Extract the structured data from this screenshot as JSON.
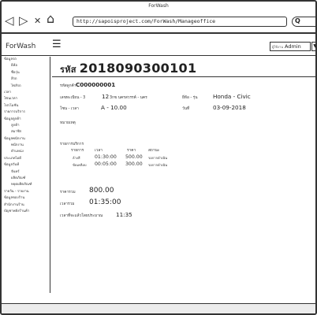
{
  "window": {
    "title": "ForWash"
  },
  "browser": {
    "back_icon": "◁",
    "forward_icon": "▷",
    "close_icon": "✕",
    "home_icon": "⌂",
    "url": "http://sapoisproject.com/ForWash/Manageoffice",
    "search_icon": "Q"
  },
  "appbar": {
    "brand": "ForWash",
    "menu_icon": "☰",
    "user_tag": "ผู้ใช้งาน",
    "user_name": "Admin",
    "user_dropdown_icon": "▼"
  },
  "sidebar": {
    "items": [
      {
        "label": "ข้อมูลรถ",
        "sub": false
      },
      {
        "label": "ยี่ห้อ",
        "sub": true
      },
      {
        "label": "ชื่อรุ่น",
        "sub": true
      },
      {
        "label": "สีรถ",
        "sub": true
      },
      {
        "label": "ไซส์รถ",
        "sub": true
      },
      {
        "label": "เวลา",
        "sub": false
      },
      {
        "label": "โซนเวลา",
        "sub": false
      },
      {
        "label": "โปรโมชั่น",
        "sub": false
      },
      {
        "label": "รายการบริการ",
        "sub": false
      },
      {
        "label": "ข้อมูลลูกค้า",
        "sub": false
      },
      {
        "label": "ลูกค้า",
        "sub": true
      },
      {
        "label": "สมาชิก",
        "sub": true
      },
      {
        "label": "ข้อมูลพนักงาน",
        "sub": false
      },
      {
        "label": "พนักงาน",
        "sub": true
      },
      {
        "label": "ตำแหน่ง",
        "sub": true
      },
      {
        "label": "ประเภทไอดี",
        "sub": false
      },
      {
        "label": "ข้อมูลวันที่",
        "sub": false
      },
      {
        "label": "จันทร์",
        "sub": true
      },
      {
        "label": "ผลิตภัณฑ์",
        "sub": true
      },
      {
        "label": "หยุดผลิตภัณฑ์",
        "sub": true
      },
      {
        "label": "รายวัน - รายงาน",
        "sub": false
      },
      {
        "label": "ข้อมูลของร้าน",
        "sub": false
      },
      {
        "label": "สำนักงานร้าน",
        "sub": false
      },
      {
        "label": "บัญชาพลังร้านค้า",
        "sub": false
      }
    ]
  },
  "main": {
    "code_label": "รหัส",
    "code_value": "2018090300101",
    "customer_label": "รหัสลูกค้า",
    "customer_code": "C000000001",
    "plate_label": "เลขทะเบียน - 3",
    "plate_value": "12",
    "plate_suffix": "3กข นครสวรรค์ - นคร",
    "brand_label": "ยี่ห้อ - รุ่น",
    "brand_value": "Honda - Civic",
    "zone_label": "โซน - เวลา",
    "zone_value": "A - 10.00",
    "date_label": "วันที่",
    "date_value": "03-09-2018",
    "note_label": "หมายเหตุ",
    "services_title": "รายการบริการ",
    "services_headers": [
      "รายการ",
      "เวลา",
      "ราคา",
      "สถานะ"
    ],
    "services": [
      {
        "name": "ล้างสี",
        "time": "01:30:00",
        "price": "500.00",
        "status": "รอการดำเนิน"
      },
      {
        "name": "ขัดเคลือบ",
        "time": "00:05:00",
        "price": "300.00",
        "status": "รอการดำเนิน"
      }
    ],
    "total_label": "ราคารวม",
    "total_value": "800.00",
    "total_time_label": "เวลารวม",
    "total_time_value": "01:35:00",
    "finish_label": "เวลาที่จะแล้วโดยประมาณ",
    "finish_value": "11:35"
  }
}
